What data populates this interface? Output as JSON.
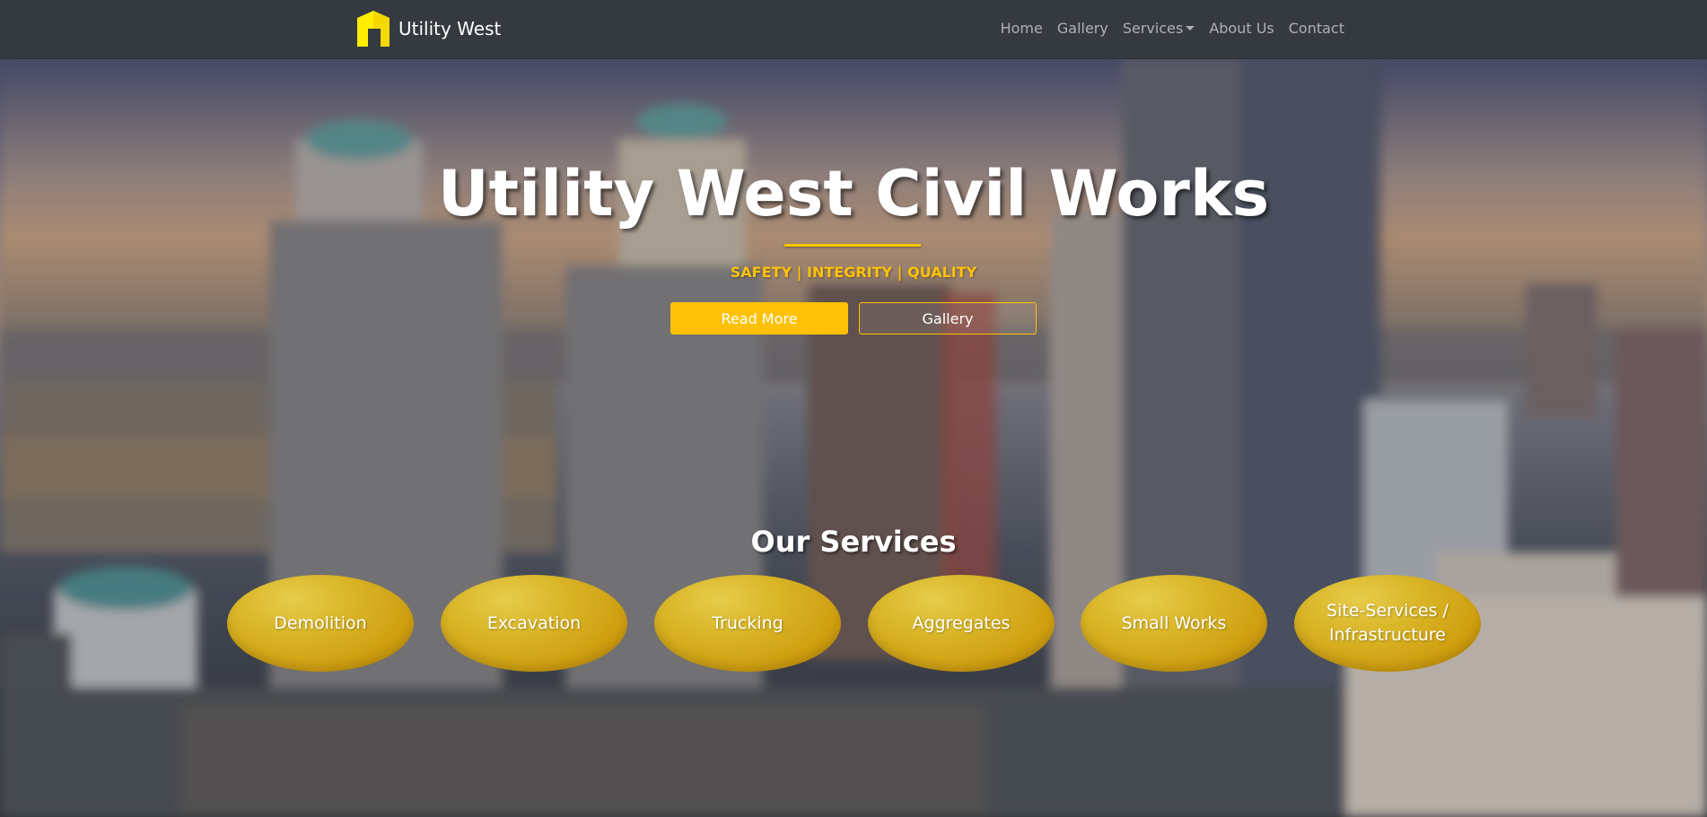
{
  "navbar": {
    "brand": "Utility West",
    "links": {
      "home": "Home",
      "gallery": "Gallery",
      "services": "Services",
      "about": "About Us",
      "contact": "Contact"
    }
  },
  "hero": {
    "title": "Utility West Civil Works",
    "tagline": "SAFETY | INTEGRITY | QUALITY",
    "read_more": "Read More",
    "gallery": "Gallery"
  },
  "services": {
    "title": "Our Services",
    "items": [
      {
        "label": "Demolition"
      },
      {
        "label": "Excavation"
      },
      {
        "label": "Trucking"
      },
      {
        "label": "Aggregates"
      },
      {
        "label": "Small Works"
      },
      {
        "label": "Site-Services / Infrastructure"
      }
    ]
  },
  "colors": {
    "navbar": "#343a40",
    "accent": "#ffc107",
    "service_bubble": "#d4a516"
  },
  "icons": {
    "logo": "brand-logo-icon"
  }
}
